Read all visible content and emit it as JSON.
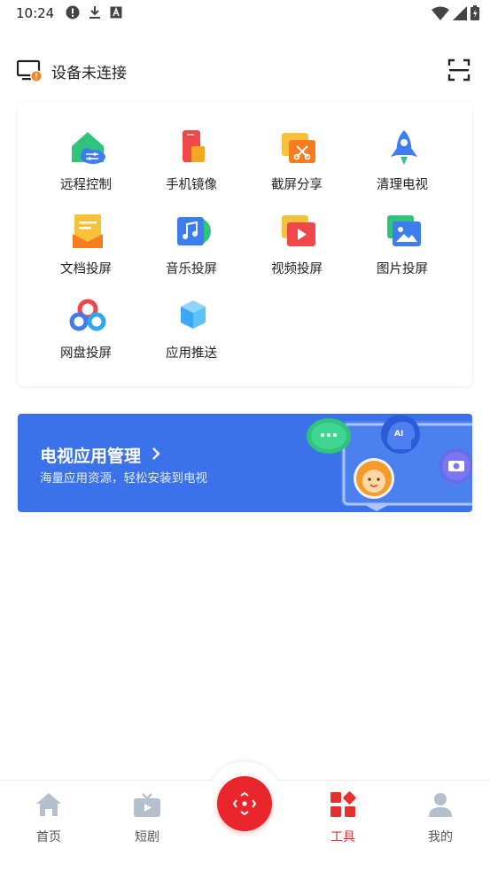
{
  "status_bar": {
    "time": "10:24",
    "left_icons": [
      "alert-icon",
      "download-icon",
      "keyboard-a-icon"
    ],
    "right_icons": [
      "wifi-icon",
      "signal-icon",
      "battery-icon"
    ]
  },
  "header": {
    "device_status": "设备未连接",
    "icons": [
      "tv-device-icon",
      "scan-icon"
    ],
    "badge_color": "#f5821f"
  },
  "tools": {
    "items": [
      {
        "label": "远程控制",
        "icon": "remote-control-icon"
      },
      {
        "label": "手机镜像",
        "icon": "phone-mirror-icon"
      },
      {
        "label": "截屏分享",
        "icon": "screenshot-share-icon"
      },
      {
        "label": "清理电视",
        "icon": "rocket-clean-icon"
      },
      {
        "label": "文档投屏",
        "icon": "document-cast-icon"
      },
      {
        "label": "音乐投屏",
        "icon": "music-cast-icon"
      },
      {
        "label": "视频投屏",
        "icon": "video-cast-icon"
      },
      {
        "label": "图片投屏",
        "icon": "image-cast-icon"
      },
      {
        "label": "网盘投屏",
        "icon": "cloud-drive-cast-icon"
      },
      {
        "label": "应用推送",
        "icon": "app-push-icon"
      }
    ]
  },
  "banner": {
    "title": "电视应用管理",
    "subtitle": "海量应用资源，轻松安装到电视",
    "ai_badge": "AI",
    "background_color": "#3b71ea"
  },
  "bottom_nav": {
    "items": [
      {
        "label": "首页",
        "icon": "home-icon",
        "active": false
      },
      {
        "label": "短剧",
        "icon": "tv-drama-icon",
        "active": false
      },
      {
        "label": "工具",
        "icon": "tools-icon",
        "active": true
      },
      {
        "label": "我的",
        "icon": "profile-icon",
        "active": false
      }
    ],
    "center_button_icon": "remote-dpad-icon",
    "active_color": "#e5302e"
  }
}
